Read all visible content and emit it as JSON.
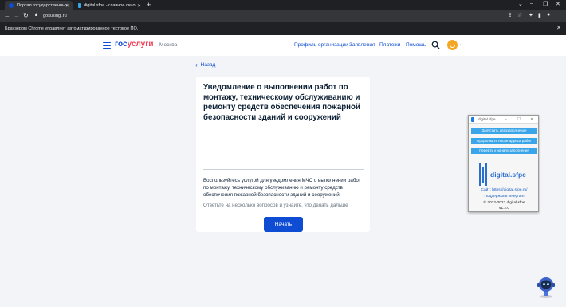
{
  "browser": {
    "tabs": [
      {
        "title": "Портал государственных услуг",
        "active": true
      },
      {
        "title": "digital.sfpe - главное окно",
        "active": false
      }
    ],
    "address": "gosuslugi.ru",
    "infobar": "Браузером Chrome управляет автоматизированное тестовое ПО."
  },
  "site": {
    "logo_part1": "гос",
    "logo_part2": "услуги",
    "city": "Москва",
    "nav": [
      "Профиль организации",
      "Заявления",
      "Платежи",
      "Помощь"
    ],
    "colors": {
      "primary": "#0d4cd3",
      "accent": "#ee3f58",
      "avatar": "#f5a623"
    }
  },
  "page": {
    "back_label": "Назад",
    "title": "Уведомление о выполнении работ по монтажу, техническому обслуживанию и ремонту средств обеспечения пожарной безопасности зданий и сооружений",
    "description": "Воспользуйтесь услугой для уведомления МЧС о выполнении работ по монтажу, техническому обслуживанию и ремонту средств обеспечения пожарной безопасности зданий и сооружений",
    "hint": "Ответьте на несколько вопросов и узнайте, что делать дальше",
    "start_button": "Начать"
  },
  "widget": {
    "title": "digital.sfpe",
    "buttons": [
      "Запустить автозаполнение",
      "Продолжить после адреса работ",
      "Перейти к началу заполнения"
    ],
    "logo_text": "digital.sfpe",
    "site": "Сайт: https://digital.sfpe.ru/",
    "support": "Поддержка в Telegram",
    "copyright": "© 2022-2023 digital.sfpe",
    "version": "v1.2.0"
  }
}
